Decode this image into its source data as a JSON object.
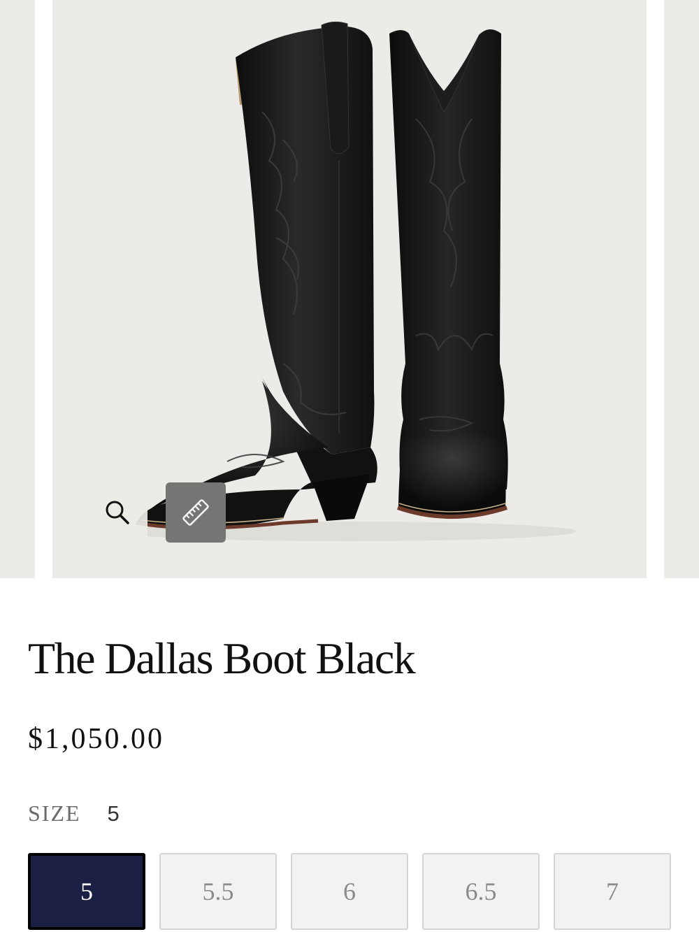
{
  "product": {
    "title": "The Dallas Boot Black",
    "price": "$1,050.00"
  },
  "gallery": {
    "icons": {
      "zoom": "search-icon",
      "measure": "ruler-icon"
    }
  },
  "size": {
    "label": "SIZE",
    "selected": "5",
    "options": [
      "5",
      "5.5",
      "6",
      "6.5",
      "7"
    ]
  },
  "colors": {
    "selected_fill": "#1b1f44",
    "image_background": "#ecebe7",
    "option_fill": "#f2f2f2"
  }
}
